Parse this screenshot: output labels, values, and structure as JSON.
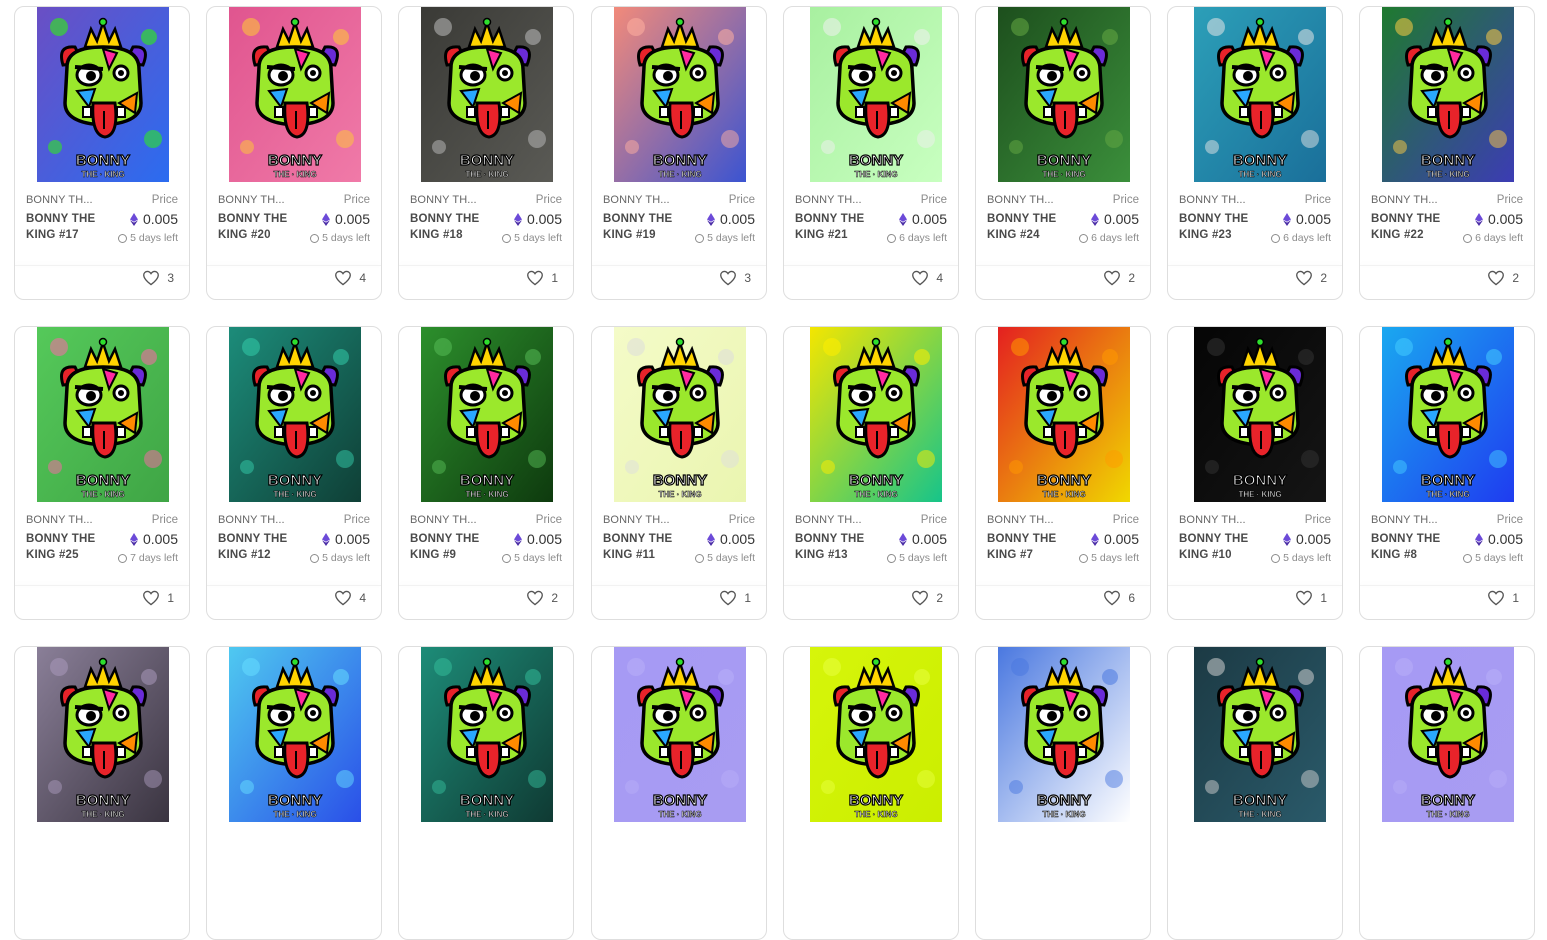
{
  "labels": {
    "price": "Price",
    "collection": "BONNY TH...",
    "currency_icon": "eth-icon"
  },
  "art_text": {
    "line1": "BONNY",
    "line2": "THE · KING"
  },
  "cards": [
    {
      "name": "BONNY THE KING #17",
      "price": "0.005",
      "time_left": "5 days left",
      "likes": "3",
      "bg": [
        "#6a4fc4",
        "#2b6cf0"
      ],
      "accent": "#2bff00"
    },
    {
      "name": "BONNY THE KING #20",
      "price": "0.005",
      "time_left": "5 days left",
      "likes": "4",
      "bg": [
        "#e0558f",
        "#f07aa8"
      ],
      "accent": "#ffcc33"
    },
    {
      "name": "BONNY THE KING #18",
      "price": "0.005",
      "time_left": "5 days left",
      "likes": "1",
      "bg": [
        "#3a3a36",
        "#5a5a55"
      ],
      "accent": "#bdbdbd"
    },
    {
      "name": "BONNY THE KING #19",
      "price": "0.005",
      "time_left": "5 days left",
      "likes": "3",
      "bg": [
        "#f28a7a",
        "#3b54d1"
      ],
      "accent": "#ffb0a0"
    },
    {
      "name": "BONNY THE KING #21",
      "price": "0.005",
      "time_left": "6 days left",
      "likes": "4",
      "bg": [
        "#a8f0a0",
        "#c8ffc0"
      ],
      "accent": "#f0f0f0"
    },
    {
      "name": "BONNY THE KING #24",
      "price": "0.005",
      "time_left": "6 days left",
      "likes": "2",
      "bg": [
        "#1d4f1d",
        "#3b8f3b"
      ],
      "accent": "#66aa44"
    },
    {
      "name": "BONNY THE KING #23",
      "price": "0.005",
      "time_left": "6 days left",
      "likes": "2",
      "bg": [
        "#2c9fb8",
        "#1a6f9a"
      ],
      "accent": "#e6e6e6"
    },
    {
      "name": "BONNY THE KING #22",
      "price": "0.005",
      "time_left": "6 days left",
      "likes": "2",
      "bg": [
        "#1f7a2f",
        "#3c3cb4"
      ],
      "accent": "#ffcc44"
    },
    {
      "name": "BONNY THE KING #25",
      "price": "0.005",
      "time_left": "7 days left",
      "likes": "1",
      "bg": [
        "#55c95a",
        "#3fa545"
      ],
      "accent": "#ff66aa"
    },
    {
      "name": "BONNY THE KING #12",
      "price": "0.005",
      "time_left": "5 days left",
      "likes": "4",
      "bg": [
        "#1c8c7a",
        "#0f3f36"
      ],
      "accent": "#33ccaa"
    },
    {
      "name": "BONNY THE KING #9",
      "price": "0.005",
      "time_left": "5 days left",
      "likes": "2",
      "bg": [
        "#2c8f2c",
        "#0e3a0e"
      ],
      "accent": "#55bb55"
    },
    {
      "name": "BONNY THE KING #11",
      "price": "0.005",
      "time_left": "5 days left",
      "likes": "1",
      "bg": [
        "#f4fbc8",
        "#eaf5b0"
      ],
      "accent": "#dddddd"
    },
    {
      "name": "BONNY THE KING #13",
      "price": "0.005",
      "time_left": "5 days left",
      "likes": "2",
      "bg": [
        "#f4e600",
        "#16c48a"
      ],
      "accent": "#ffee00"
    },
    {
      "name": "BONNY THE KING #7",
      "price": "0.005",
      "time_left": "5 days left",
      "likes": "6",
      "bg": [
        "#e42020",
        "#f0d800"
      ],
      "accent": "#ff9900"
    },
    {
      "name": "BONNY THE KING #10",
      "price": "0.005",
      "time_left": "5 days left",
      "likes": "1",
      "bg": [
        "#050505",
        "#151515"
      ],
      "accent": "#333333"
    },
    {
      "name": "BONNY THE KING #8",
      "price": "0.005",
      "time_left": "5 days left",
      "likes": "1",
      "bg": [
        "#1aa8f0",
        "#1f3cf0"
      ],
      "accent": "#44ccff"
    },
    {
      "name": "",
      "price": "",
      "time_left": "",
      "likes": "",
      "bg": [
        "#8a7f98",
        "#3a3440"
      ],
      "accent": "#aa99bb"
    },
    {
      "name": "",
      "price": "",
      "time_left": "",
      "likes": "",
      "bg": [
        "#4fc9f0",
        "#2a4fe8"
      ],
      "accent": "#66ddff"
    },
    {
      "name": "",
      "price": "",
      "time_left": "",
      "likes": "",
      "bg": [
        "#1d8c78",
        "#0f3a33"
      ],
      "accent": "#33bb99"
    },
    {
      "name": "",
      "price": "",
      "time_left": "",
      "likes": "",
      "bg": [
        "#a69af4",
        "#a89cf2"
      ],
      "accent": "#b8aef8"
    },
    {
      "name": "",
      "price": "",
      "time_left": "",
      "likes": "",
      "bg": [
        "#d6f50a",
        "#cbee00"
      ],
      "accent": "#e8ff40"
    },
    {
      "name": "",
      "price": "",
      "time_left": "",
      "likes": "",
      "bg": [
        "#4a78e0",
        "#ffffff"
      ],
      "accent": "#4a78e0"
    },
    {
      "name": "",
      "price": "",
      "time_left": "",
      "likes": "",
      "bg": [
        "#1c3a44",
        "#2a5a6a"
      ],
      "accent": "#cfcfcf"
    },
    {
      "name": "",
      "price": "",
      "time_left": "",
      "likes": "",
      "bg": [
        "#a69af4",
        "#a89cf2"
      ],
      "accent": "#b8aef8"
    }
  ]
}
